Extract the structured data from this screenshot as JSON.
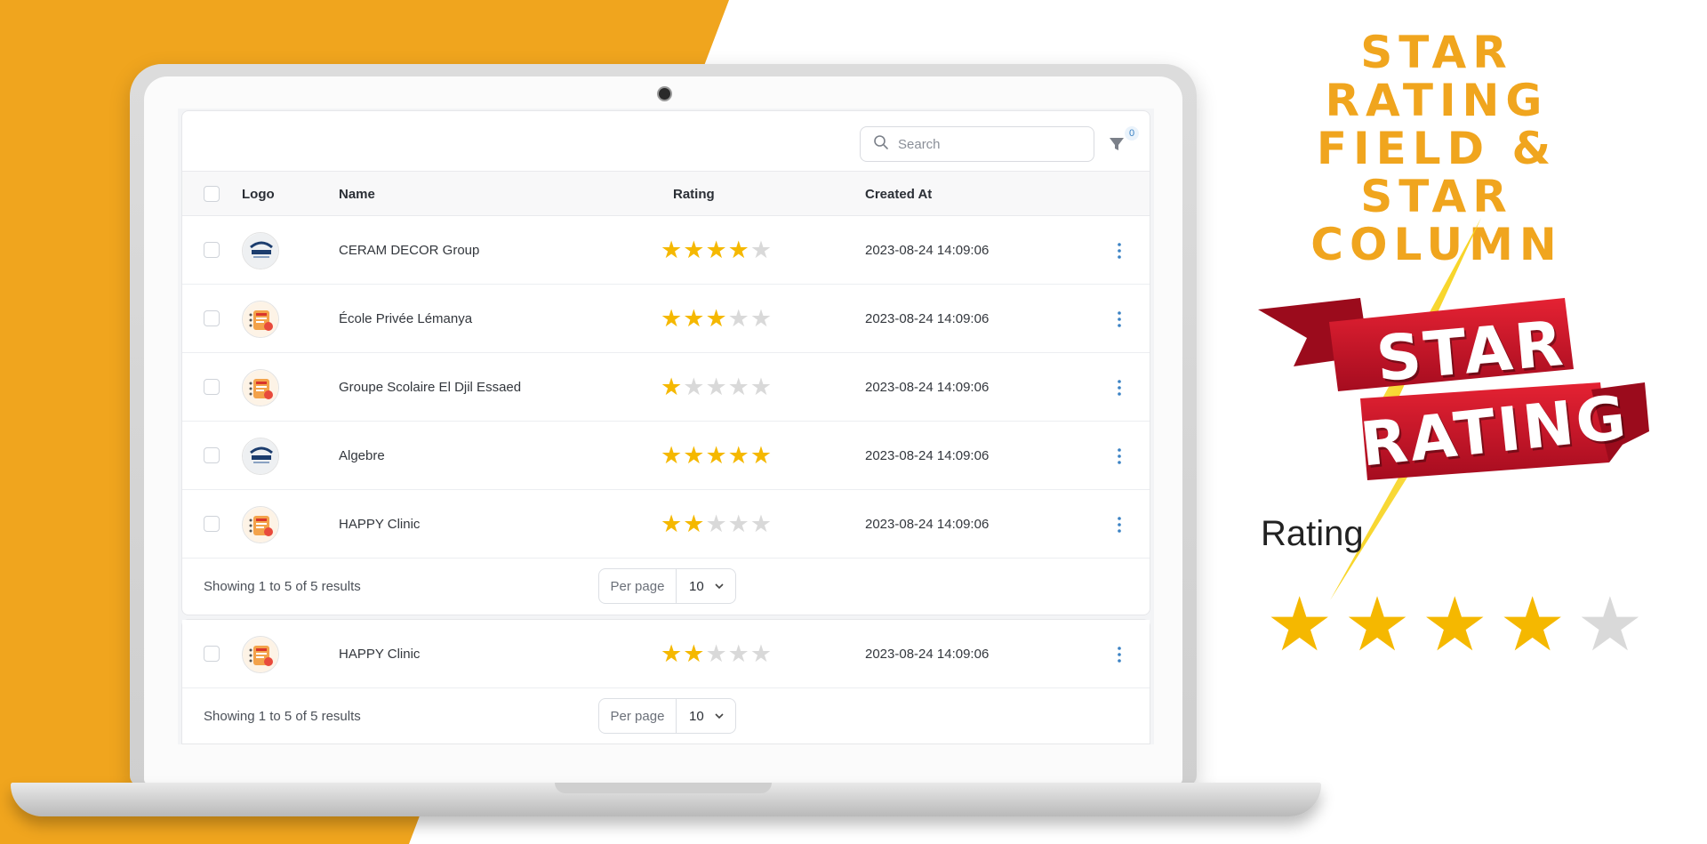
{
  "promo": {
    "title_line1": "STAR RATING",
    "title_line2": "FIELD & STAR",
    "title_line3": "COLUMN",
    "ribbon_line1": "STAR",
    "ribbon_line2": "RATING",
    "rating_label": "Rating",
    "rating_value": 4,
    "rating_max": 5
  },
  "toolbar": {
    "search_placeholder": "Search",
    "search_icon": "search-icon",
    "filter_icon": "filter-icon",
    "filter_count": "0"
  },
  "table": {
    "headers": {
      "logo": "Logo",
      "name": "Name",
      "rating": "Rating",
      "created_at": "Created At"
    },
    "rows": [
      {
        "name": "CERAM DECOR Group",
        "rating": 4,
        "created_at": "2023-08-24 14:09:06",
        "logo_style": "ceram"
      },
      {
        "name": "École Privée Lémanya",
        "rating": 3,
        "created_at": "2023-08-24 14:09:06",
        "logo_style": "happy"
      },
      {
        "name": "Groupe Scolaire El Djil Essaed",
        "rating": 1,
        "created_at": "2023-08-24 14:09:06",
        "logo_style": "happy"
      },
      {
        "name": "Algebre",
        "rating": 5,
        "created_at": "2023-08-24 14:09:06",
        "logo_style": "ceram"
      },
      {
        "name": "HAPPY Clinic",
        "rating": 2,
        "created_at": "2023-08-24 14:09:06",
        "logo_style": "happy"
      }
    ],
    "results_text": "Showing 1 to 5 of 5 results",
    "per_page_label": "Per page",
    "per_page_value": "10"
  },
  "strip": {
    "row": {
      "name": "HAPPY Clinic",
      "rating": 2,
      "created_at": "2023-08-24 14:09:06",
      "logo_style": "happy"
    },
    "results_text": "Showing 1 to 5 of 5 results",
    "per_page_label": "Per page",
    "per_page_value": "10"
  },
  "colors": {
    "brand_orange": "#f0a51e",
    "star_filled": "#f5b800",
    "star_empty": "#d9d9d9",
    "ribbon_red": "#c8102e",
    "row_menu": "#3b82c4"
  }
}
